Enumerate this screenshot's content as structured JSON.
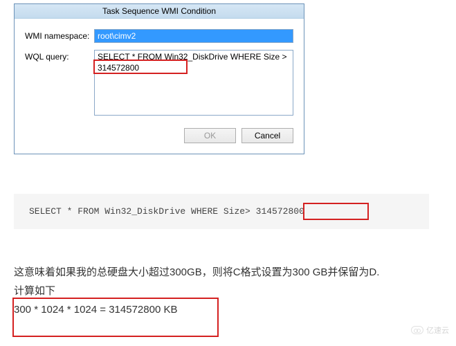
{
  "dialog": {
    "title": "Task Sequence WMI Condition",
    "namespace_label": "WMI namespace:",
    "namespace_value": "root\\cimv2",
    "query_label": "WQL query:",
    "query_value": "SELECT * FROM Win32_DiskDrive WHERE Size > 314572800",
    "ok_button": "OK",
    "cancel_button": "Cancel"
  },
  "code_block": {
    "text": "SELECT * FROM Win32_DiskDrive WHERE Size> 314572800"
  },
  "explanation": {
    "line1": "这意味着如果我的总硬盘大小超过300GB，则将C格式设置为300 GB并保留为D.",
    "line2": "计算如下",
    "line3": "300 * 1024 * 1024 = 314572800 KB"
  },
  "watermark": {
    "text": "亿速云"
  }
}
